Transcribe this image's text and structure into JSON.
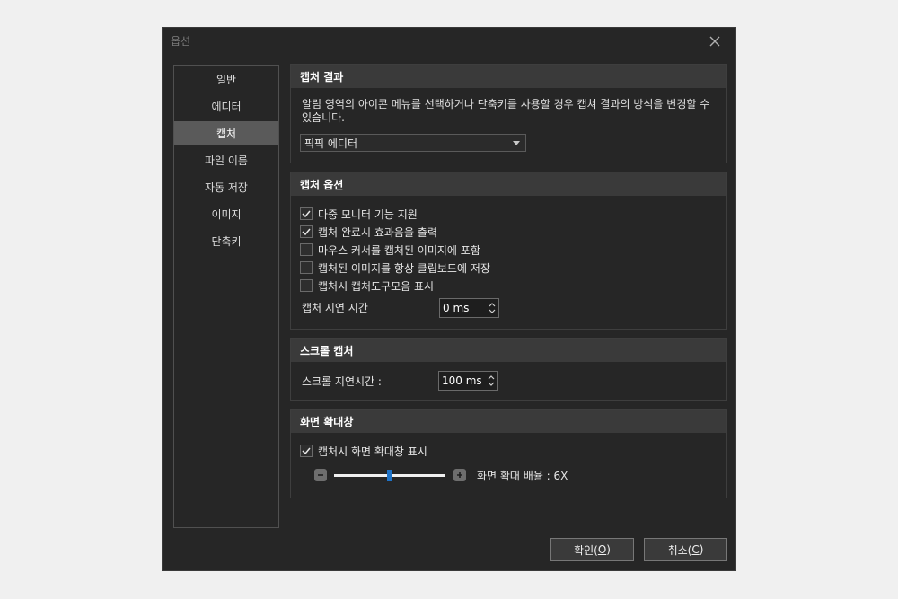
{
  "dialog": {
    "title": "옵션"
  },
  "sidebar": {
    "items": [
      {
        "label": "일반"
      },
      {
        "label": "에디터"
      },
      {
        "label": "캡처",
        "active": true
      },
      {
        "label": "파일 이름"
      },
      {
        "label": "자동 저장"
      },
      {
        "label": "이미지"
      },
      {
        "label": "단축키"
      }
    ]
  },
  "capture_result": {
    "header": "캡처 결과",
    "description": "알림 영역의 아이콘 메뉴를 선택하거나 단축키를 사용할 경우 캡쳐 결과의 방식을 변경할 수 있습니다.",
    "select_value": "픽픽 에디터"
  },
  "capture_options": {
    "header": "캡처 옵션",
    "checkboxes": [
      {
        "label": "다중 모니터 기능 지원",
        "checked": true
      },
      {
        "label": "캡처 완료시 효과음을 출력",
        "checked": true
      },
      {
        "label": "마우스 커서를 캡처된 이미지에 포함",
        "checked": false
      },
      {
        "label": "캡처된 이미지를 항상 클립보드에 저장",
        "checked": false
      },
      {
        "label": "캡처시 캡처도구모음 표시",
        "checked": false
      }
    ],
    "delay_label": "캡처 지연 시간",
    "delay_value": "0 ms"
  },
  "scroll_capture": {
    "header": "스크롤 캡처",
    "delay_label": "스크롤 지연시간 :",
    "delay_value": "100 ms"
  },
  "magnifier": {
    "header": "화면 확대창",
    "checkbox": {
      "label": "캡처시 화면 확대창 표시",
      "checked": true
    },
    "zoom_label": "화면 확대 배율 : 6X",
    "zoom_level": 6,
    "zoom_fraction": 0.5
  },
  "buttons": {
    "ok_text": "확인(",
    "ok_key": "O",
    "ok_close": ")",
    "cancel_text": "취소(",
    "cancel_key": "C",
    "cancel_close": ")"
  },
  "colors": {
    "background": "#262626",
    "accent": "#1e73c8",
    "section_header": "#3a3a3a"
  }
}
